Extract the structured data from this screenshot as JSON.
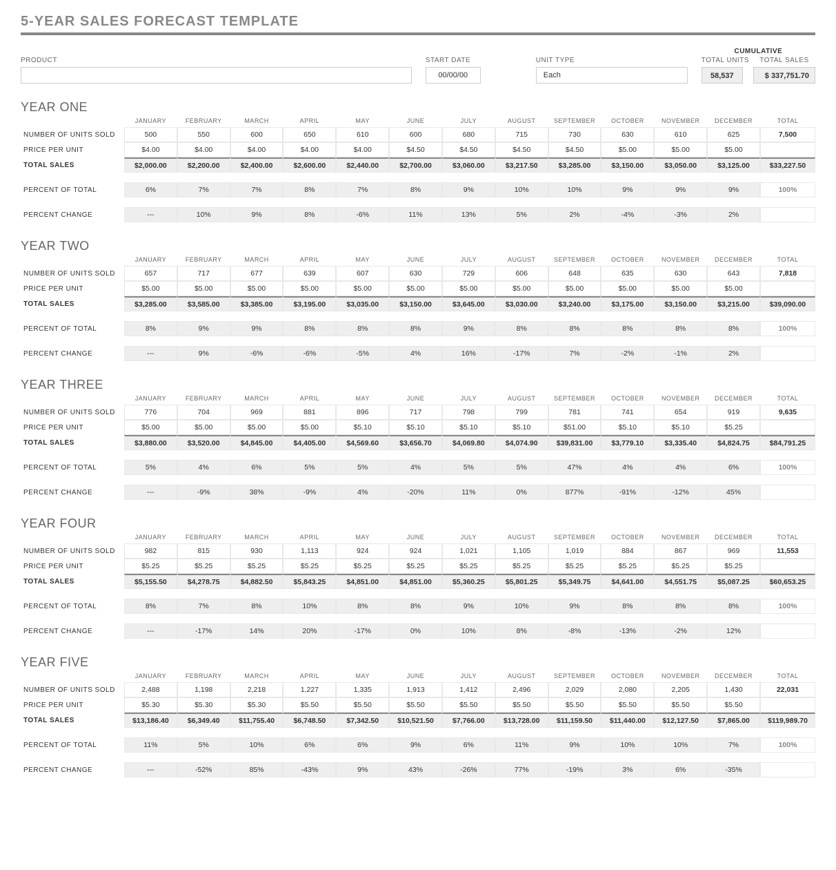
{
  "title": "5-YEAR SALES FORECAST TEMPLATE",
  "header": {
    "product_label": "PRODUCT",
    "product_value": "",
    "startdate_label": "START DATE",
    "startdate_value": "00/00/00",
    "unittype_label": "UNIT TYPE",
    "unittype_value": "Each",
    "cumulative_label": "CUMULATIVE",
    "total_units_label": "TOTAL UNITS",
    "total_units_value": "58,537",
    "total_sales_label": "TOTAL SALES",
    "total_sales_value": "$ 337,751.70"
  },
  "months": [
    "JANUARY",
    "FEBRUARY",
    "MARCH",
    "APRIL",
    "MAY",
    "JUNE",
    "JULY",
    "AUGUST",
    "SEPTEMBER",
    "OCTOBER",
    "NOVEMBER",
    "DECEMBER"
  ],
  "total_label": "TOTAL",
  "row_labels": {
    "units": "NUMBER OF UNITS SOLD",
    "price": "PRICE PER UNIT",
    "sales": "TOTAL SALES",
    "pct_total": "PERCENT OF TOTAL",
    "pct_change": "PERCENT CHANGE"
  },
  "year1": {
    "title": "YEAR ONE",
    "units": [
      "500",
      "550",
      "600",
      "650",
      "610",
      "600",
      "680",
      "715",
      "730",
      "630",
      "610",
      "625"
    ],
    "units_total": "7,500",
    "price": [
      "$4.00",
      "$4.00",
      "$4.00",
      "$4.00",
      "$4.00",
      "$4.50",
      "$4.50",
      "$4.50",
      "$4.50",
      "$5.00",
      "$5.00",
      "$5.00"
    ],
    "sales": [
      "$2,000.00",
      "$2,200.00",
      "$2,400.00",
      "$2,600.00",
      "$2,440.00",
      "$2,700.00",
      "$3,060.00",
      "$3,217.50",
      "$3,285.00",
      "$3,150.00",
      "$3,050.00",
      "$3,125.00"
    ],
    "sales_total": "$33,227.50",
    "pct_total": [
      "6%",
      "7%",
      "7%",
      "8%",
      "7%",
      "8%",
      "9%",
      "10%",
      "10%",
      "9%",
      "9%",
      "9%"
    ],
    "pct_total_total": "100%",
    "pct_change": [
      "---",
      "10%",
      "9%",
      "8%",
      "-6%",
      "11%",
      "13%",
      "5%",
      "2%",
      "-4%",
      "-3%",
      "2%"
    ]
  },
  "year2": {
    "title": "YEAR TWO",
    "units": [
      "657",
      "717",
      "677",
      "639",
      "607",
      "630",
      "729",
      "606",
      "648",
      "635",
      "630",
      "643"
    ],
    "units_total": "7,818",
    "price": [
      "$5.00",
      "$5.00",
      "$5.00",
      "$5.00",
      "$5.00",
      "$5.00",
      "$5.00",
      "$5.00",
      "$5.00",
      "$5.00",
      "$5.00",
      "$5.00"
    ],
    "sales": [
      "$3,285.00",
      "$3,585.00",
      "$3,385.00",
      "$3,195.00",
      "$3,035.00",
      "$3,150.00",
      "$3,645.00",
      "$3,030.00",
      "$3,240.00",
      "$3,175.00",
      "$3,150.00",
      "$3,215.00"
    ],
    "sales_total": "$39,090.00",
    "pct_total": [
      "8%",
      "9%",
      "9%",
      "8%",
      "8%",
      "8%",
      "9%",
      "8%",
      "8%",
      "8%",
      "8%",
      "8%"
    ],
    "pct_total_total": "100%",
    "pct_change": [
      "---",
      "9%",
      "-6%",
      "-6%",
      "-5%",
      "4%",
      "16%",
      "-17%",
      "7%",
      "-2%",
      "-1%",
      "2%"
    ]
  },
  "year3": {
    "title": "YEAR THREE",
    "units": [
      "776",
      "704",
      "969",
      "881",
      "896",
      "717",
      "798",
      "799",
      "781",
      "741",
      "654",
      "919"
    ],
    "units_total": "9,635",
    "price": [
      "$5.00",
      "$5.00",
      "$5.00",
      "$5.00",
      "$5.10",
      "$5.10",
      "$5.10",
      "$5.10",
      "$51.00",
      "$5.10",
      "$5.10",
      "$5.25"
    ],
    "sales": [
      "$3,880.00",
      "$3,520.00",
      "$4,845.00",
      "$4,405.00",
      "$4,569.60",
      "$3,656.70",
      "$4,069.80",
      "$4,074.90",
      "$39,831.00",
      "$3,779.10",
      "$3,335.40",
      "$4,824.75"
    ],
    "sales_total": "$84,791.25",
    "pct_total": [
      "5%",
      "4%",
      "6%",
      "5%",
      "5%",
      "4%",
      "5%",
      "5%",
      "47%",
      "4%",
      "4%",
      "6%"
    ],
    "pct_total_total": "100%",
    "pct_change": [
      "---",
      "-9%",
      "38%",
      "-9%",
      "4%",
      "-20%",
      "11%",
      "0%",
      "877%",
      "-91%",
      "-12%",
      "45%"
    ]
  },
  "year4": {
    "title": "YEAR FOUR",
    "units": [
      "982",
      "815",
      "930",
      "1,113",
      "924",
      "924",
      "1,021",
      "1,105",
      "1,019",
      "884",
      "867",
      "969"
    ],
    "units_total": "11,553",
    "price": [
      "$5.25",
      "$5.25",
      "$5.25",
      "$5.25",
      "$5.25",
      "$5.25",
      "$5.25",
      "$5.25",
      "$5.25",
      "$5.25",
      "$5.25",
      "$5.25"
    ],
    "sales": [
      "$5,155.50",
      "$4,278.75",
      "$4,882.50",
      "$5,843.25",
      "$4,851.00",
      "$4,851.00",
      "$5,360.25",
      "$5,801.25",
      "$5,349.75",
      "$4,641.00",
      "$4,551.75",
      "$5,087.25"
    ],
    "sales_total": "$60,653.25",
    "pct_total": [
      "8%",
      "7%",
      "8%",
      "10%",
      "8%",
      "8%",
      "9%",
      "10%",
      "9%",
      "8%",
      "8%",
      "8%"
    ],
    "pct_total_total": "100%",
    "pct_change": [
      "---",
      "-17%",
      "14%",
      "20%",
      "-17%",
      "0%",
      "10%",
      "8%",
      "-8%",
      "-13%",
      "-2%",
      "12%"
    ]
  },
  "year5": {
    "title": "YEAR FIVE",
    "units": [
      "2,488",
      "1,198",
      "2,218",
      "1,227",
      "1,335",
      "1,913",
      "1,412",
      "2,496",
      "2,029",
      "2,080",
      "2,205",
      "1,430"
    ],
    "units_total": "22,031",
    "price": [
      "$5.30",
      "$5.30",
      "$5.30",
      "$5.50",
      "$5.50",
      "$5.50",
      "$5.50",
      "$5.50",
      "$5.50",
      "$5.50",
      "$5.50",
      "$5.50"
    ],
    "sales": [
      "$13,186.40",
      "$6,349.40",
      "$11,755.40",
      "$6,748.50",
      "$7,342.50",
      "$10,521.50",
      "$7,766.00",
      "$13,728.00",
      "$11,159.50",
      "$11,440.00",
      "$12,127.50",
      "$7,865.00"
    ],
    "sales_total": "$119,989.70",
    "pct_total": [
      "11%",
      "5%",
      "10%",
      "6%",
      "6%",
      "9%",
      "6%",
      "11%",
      "9%",
      "10%",
      "10%",
      "7%"
    ],
    "pct_total_total": "100%",
    "pct_change": [
      "---",
      "-52%",
      "85%",
      "-43%",
      "9%",
      "43%",
      "-26%",
      "77%",
      "-19%",
      "3%",
      "6%",
      "-35%"
    ]
  }
}
